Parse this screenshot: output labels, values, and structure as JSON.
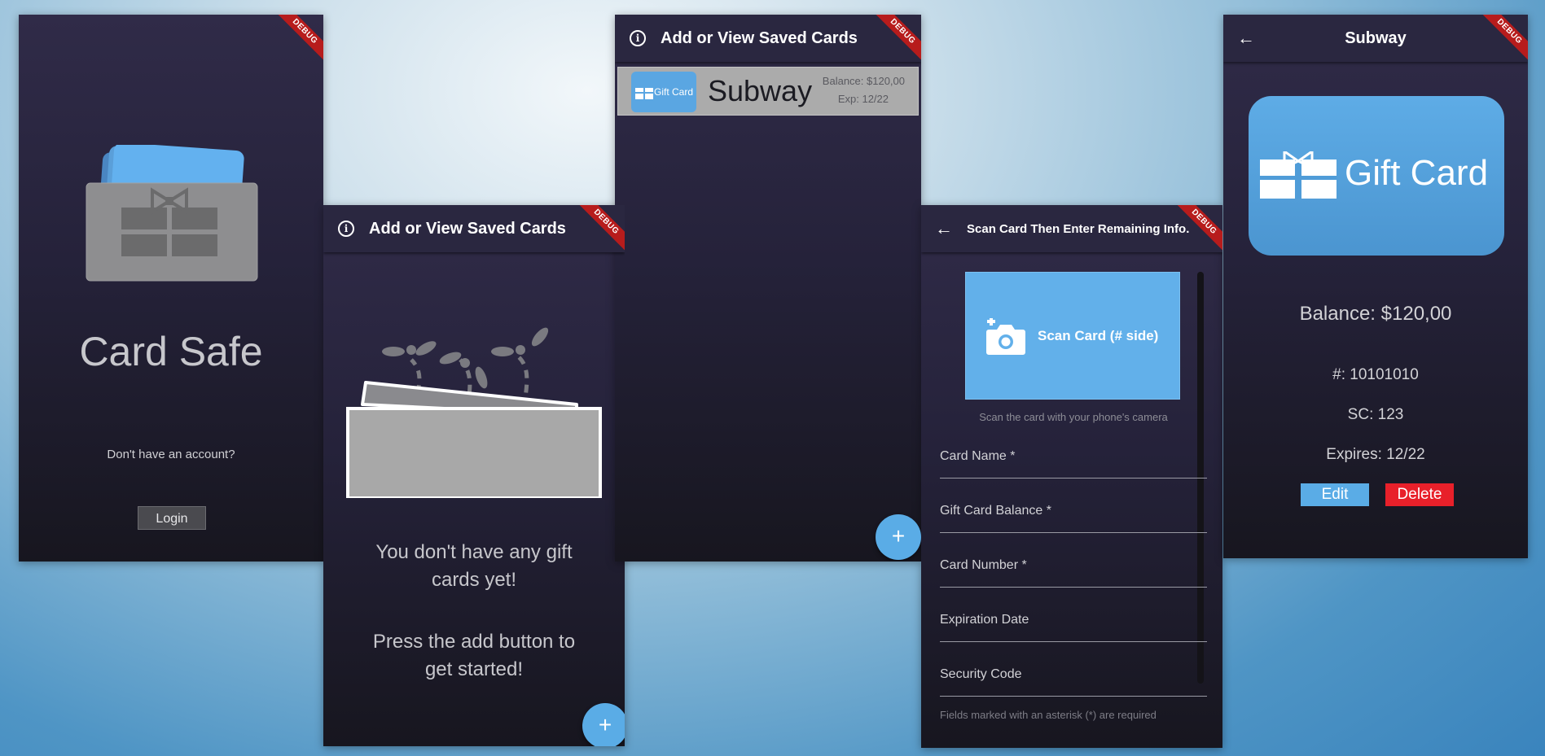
{
  "debug_label": "DEBUG",
  "login_screen": {
    "app_title": "Card Safe",
    "no_account_text": "Don't have an account?",
    "login_button": "Login"
  },
  "empty_screen": {
    "appbar_title": "Add or View Saved Cards",
    "empty_message": "You don't have any gift cards yet!",
    "hint_message": "Press the add button to get started!",
    "fab_label": "+"
  },
  "list_screen": {
    "appbar_title": "Add or View Saved Cards",
    "cards": [
      {
        "thumbnail_text": "Gift Card",
        "name": "Subway",
        "balance": "Balance: $120,00",
        "expiry": "Exp: 12/22"
      }
    ],
    "fab_label": "+"
  },
  "scan_screen": {
    "appbar_title": "Scan Card Then Enter Remaining Info.",
    "scan_button": "Scan Card (# side)",
    "scan_hint": "Scan the card with your phone's camera",
    "fields": [
      "Card Name *",
      "Gift Card Balance *",
      "Card Number *",
      "Expiration Date",
      "Security Code"
    ],
    "required_note": "Fields marked with an asterisk (*) are required"
  },
  "detail_screen": {
    "appbar_title": "Subway",
    "card_text": "Gift Card",
    "balance": "Balance: $120,00",
    "number": "#: 10101010",
    "security_code": "SC: 123",
    "expires": "Expires: 12/22",
    "edit_button": "Edit",
    "delete_button": "Delete"
  },
  "colors": {
    "accent_blue": "#5aace6",
    "card_blue": "#4f9fd9",
    "delete_red": "#e8202a",
    "appbar": "#2a2740",
    "debug_red": "#b71c1c"
  },
  "icons": [
    "info-icon",
    "back-arrow-icon",
    "add-icon",
    "camera-add-icon",
    "gift-icon",
    "wallet-icon",
    "cards-icon"
  ]
}
